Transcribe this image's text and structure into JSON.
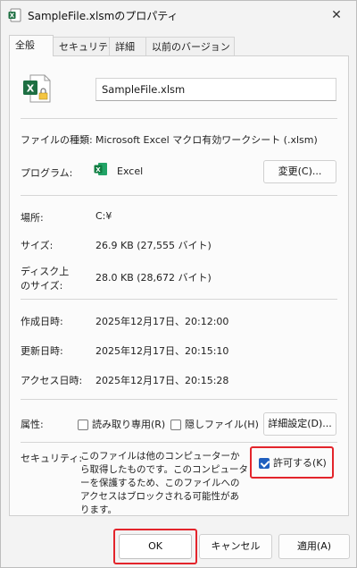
{
  "titlebar": {
    "title": "SampleFile.xlsmのプロパティ",
    "close_glyph": "✕"
  },
  "tabs": [
    {
      "label": "全般",
      "active": true
    },
    {
      "label": "セキュリティ",
      "active": false
    },
    {
      "label": "詳細",
      "active": false
    },
    {
      "label": "以前のバージョン",
      "active": false
    }
  ],
  "general": {
    "file_name": "SampleFile.xlsm",
    "file_type_label": "ファイルの種類:",
    "file_type_value": "Microsoft Excel マクロ有効ワークシート (.xlsm)",
    "program_label": "プログラム:",
    "program_value": "Excel",
    "change_button": "変更(C)...",
    "location_label": "場所:",
    "location_value": "C:¥",
    "size_label": "サイズ:",
    "size_value": "26.9 KB (27,555 バイト)",
    "disk_size_label_1": "ディスク上",
    "disk_size_label_2": "のサイズ:",
    "disk_size_value": "28.0 KB (28,672 バイト)",
    "created_label": "作成日時:",
    "created_value": "2025年12月17日、20:12:00",
    "modified_label": "更新日時:",
    "modified_value": "2025年12月17日、20:15:10",
    "accessed_label": "アクセス日時:",
    "accessed_value": "2025年12月17日、20:15:28",
    "attributes_label": "属性:",
    "readonly_label": "読み取り専用(R)",
    "hidden_label": "隠しファイル(H)",
    "advanced_button": "詳細設定(D)...",
    "security_label": "セキュリティ:",
    "security_text": "このファイルは他のコンピューターから取得したものです。このコンピューターを保護するため、このファイルへのアクセスはブロックされる可能性があります。",
    "unblock_label": "許可する(K)",
    "unblock_checked": true
  },
  "footer": {
    "ok": "OK",
    "cancel": "キャンセル",
    "apply": "適用(A)"
  },
  "colors": {
    "highlight": "#e3242b",
    "excel_green": "#1d6f42",
    "checkbox_blue": "#1f5fbf"
  },
  "icons": {
    "title": "excel-file-icon",
    "file": "excel-macro-file-icon",
    "program": "excel-app-icon",
    "close": "close-icon"
  }
}
